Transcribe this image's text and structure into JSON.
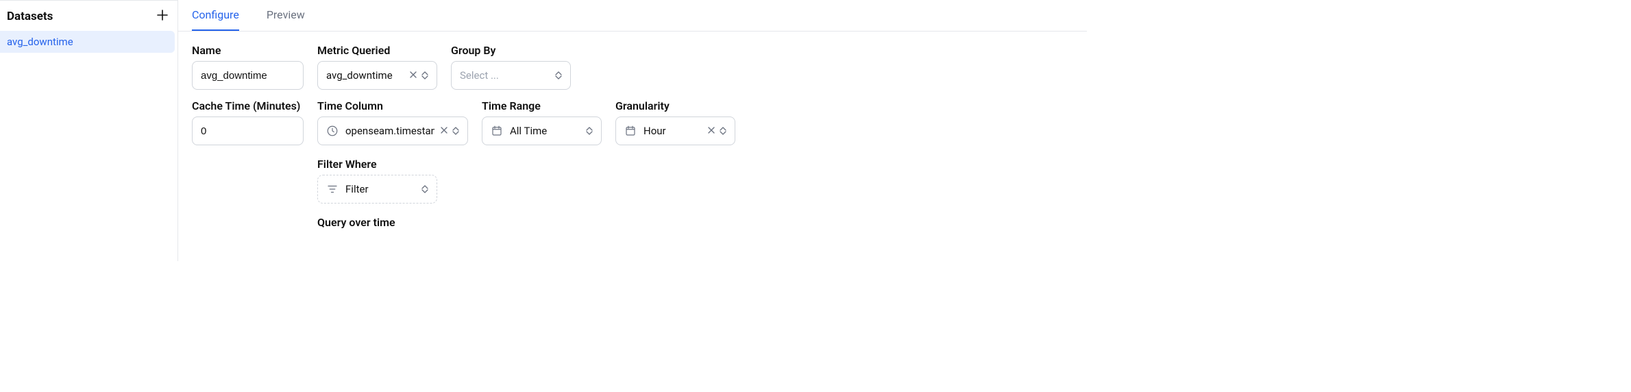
{
  "sidebar": {
    "title": "Datasets",
    "items": [
      {
        "label": "avg_downtime"
      }
    ]
  },
  "tabs": {
    "items": [
      {
        "label": "Configure",
        "active": true
      },
      {
        "label": "Preview",
        "active": false
      }
    ]
  },
  "form": {
    "name": {
      "label": "Name",
      "value": "avg_downtime"
    },
    "metric": {
      "label": "Metric Queried",
      "value": "avg_downtime"
    },
    "group_by": {
      "label": "Group By",
      "placeholder": "Select ..."
    },
    "cache_time": {
      "label": "Cache Time (Minutes)",
      "value": "0"
    },
    "time_column": {
      "label": "Time Column",
      "value": "openseam.timestamp"
    },
    "time_range": {
      "label": "Time Range",
      "value": "All Time"
    },
    "granularity": {
      "label": "Granularity",
      "value": "Hour"
    },
    "filter": {
      "label": "Filter Where",
      "button": "Filter"
    },
    "query_over_time": {
      "label": "Query over time"
    }
  }
}
